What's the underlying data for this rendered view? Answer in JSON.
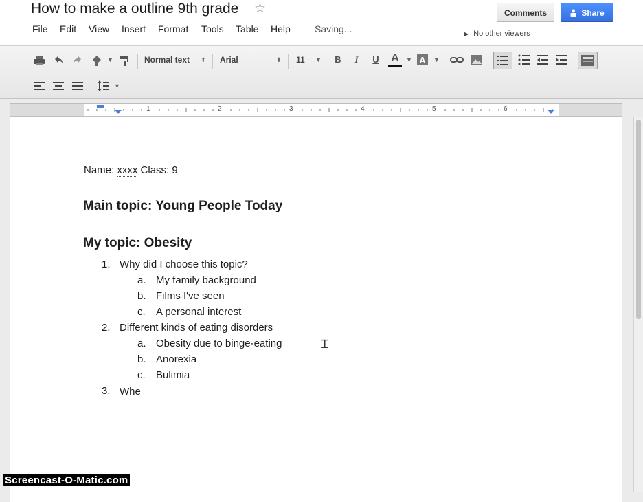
{
  "header": {
    "title": "How to make a outline 9th grade",
    "star_icon": "star-outline-icon",
    "menu": [
      "File",
      "Edit",
      "View",
      "Insert",
      "Format",
      "Tools",
      "Table",
      "Help"
    ],
    "status": "Saving...",
    "comments_label": "Comments",
    "share_label": "Share",
    "share_icon": "person-lock-icon",
    "viewers_text": "No other viewers"
  },
  "toolbar": {
    "style_select": "Normal text",
    "font_select": "Arial",
    "size_select": "11",
    "bold_label": "B",
    "italic_label": "I",
    "underline_label": "U",
    "text_color_label": "A",
    "text_color_bar": "#111111",
    "highlight_label": "A"
  },
  "ruler": {
    "numbers": [
      "1",
      "2",
      "3",
      "4",
      "5",
      "6"
    ]
  },
  "document": {
    "name_label": "Name:",
    "name_value": "xxxx",
    "class_text": "Class: 9",
    "main_topic": "Main topic: Young People Today",
    "my_topic": "My topic: Obesity",
    "outline": [
      {
        "num": "1.",
        "text": "Why did I choose this topic?",
        "subitems": [
          {
            "letter": "a.",
            "text": "My family background"
          },
          {
            "letter": "b.",
            "text": "Films I've seen"
          },
          {
            "letter": "c.",
            "text": "A personal interest"
          }
        ]
      },
      {
        "num": "2.",
        "text": "Different kinds of eating disorders",
        "subitems": [
          {
            "letter": "a.",
            "text": "Obesity due to binge-eating"
          },
          {
            "letter": "b.",
            "text": "Anorexia"
          },
          {
            "letter": "c.",
            "text": "Bulimia"
          }
        ]
      },
      {
        "num": "3.",
        "text": "Whe",
        "subitems": []
      }
    ]
  },
  "watermark": "Screencast-O-Matic.com",
  "colors": {
    "share_button": "#3d7ff0",
    "page": "#ffffff",
    "toolbar": "#ededed"
  }
}
